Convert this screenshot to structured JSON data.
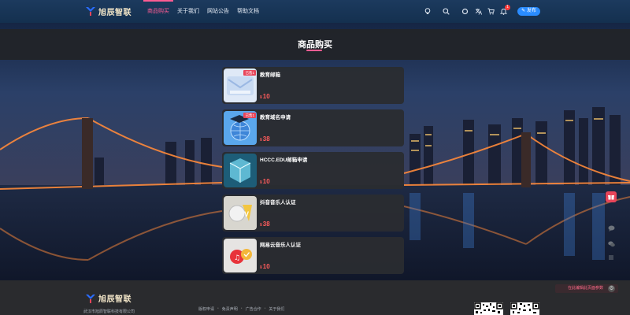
{
  "header": {
    "logo_text": "旭辰智联",
    "nav": [
      {
        "label": "商品购买",
        "active": true
      },
      {
        "label": "关于我们",
        "active": false
      },
      {
        "label": "网站公告",
        "active": false
      },
      {
        "label": "帮助文档",
        "active": false
      }
    ],
    "icons": [
      "lightbulb-icon",
      "search-icon",
      "theme-icon",
      "translate-icon",
      "cart-icon",
      "bell-icon"
    ],
    "notification_count": "1",
    "publish_label": "发布"
  },
  "page": {
    "title": "商品购买"
  },
  "products": [
    {
      "name": "教育邮箱",
      "currency": "¥",
      "price": "10",
      "badge": "已售1"
    },
    {
      "name": "教育域名申请",
      "currency": "¥",
      "price": "38",
      "badge": "已售1"
    },
    {
      "name": "HCCC.EDU邮箱申请",
      "currency": "¥",
      "price": "10",
      "badge": ""
    },
    {
      "name": "抖音音乐人认证",
      "currency": "¥",
      "price": "38",
      "badge": ""
    },
    {
      "name": "网易云音乐人认证",
      "currency": "¥",
      "price": "10",
      "badge": ""
    }
  ],
  "footer": {
    "logo_text": "旭辰智联",
    "company": "武汉市旭辰智联科技有限公司",
    "links": [
      "版权申请",
      "免责声明",
      "广告合作",
      "关于我们"
    ],
    "edit_label": "在此编辑此页面参数"
  },
  "colors": {
    "accent": "#ff5c93",
    "price": "#ff5c5c",
    "publish": "#2a8cff"
  }
}
